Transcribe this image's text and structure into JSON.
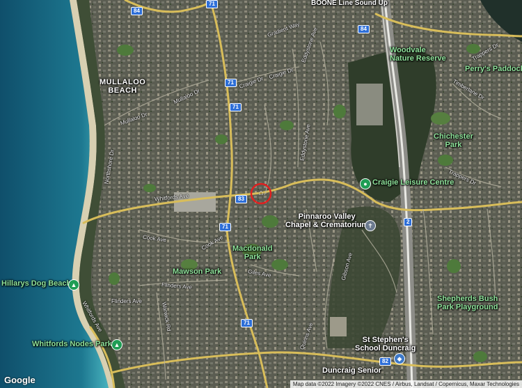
{
  "map": {
    "logo": "Google",
    "attribution": "Map data ©2022 Imagery ©2022 CNES / Airbus, Landsat / Copernicus, Maxar Technologies",
    "marker": "location-pin",
    "colors": {
      "ocean": "#1d6f8a",
      "shallow": "#3aa6b6",
      "land": "#5a5c50",
      "road": "#e8cf7a",
      "freeway": "#f3f3f3",
      "park_label": "#8fe39b",
      "marker": "#e02020"
    }
  },
  "labels": {
    "mullaloo_beach": "MULLALOO\nBEACH",
    "woodvale_reserve": "Woodvale\nNature Reserve",
    "perrys_paddock": "Perry's Paddock",
    "chichester_park": "Chichester\nPark",
    "craigie_leisure": "Craigie Leisure Centre",
    "pinnaroo": "Pinnaroo Valley\nChapel & Crematorium",
    "macdonald_park": "Macdonald\nPark",
    "mawson_park": "Mawson Park",
    "hillarys_dog_beach": "Hillarys Dog Beach",
    "whitfords_nodes": "Whitfords Nodes Park",
    "shepherds_bush": "Shepherds Bush\nPark Playground",
    "st_stephens": "St Stephen's\nSchool Duncraig",
    "duncraig_senior": "Duncraig Senior",
    "boone": "BOONE Line Sound Up"
  },
  "roads": {
    "whitfords_ave": "Whitfords Ave",
    "craigie_dr_1": "Craigie Dr",
    "craigie_dr_2": "Craigie Dr",
    "mullaloo_dr_1": "Mullaloo Dr",
    "mullaloo_dr_2": "Mullaloo Dr",
    "gradient_way": "Gradient Way",
    "eddystone_ave": "Eddystone Ave",
    "eddystone_ave_2": "Eddystone Ave",
    "timberlane_dr": "Timberlane Dr",
    "trappers_dr": "Trappers Dr",
    "trappers_dr_2": "Trappers Dr",
    "cook_ave": "Cook Ave",
    "cook_ave_2": "Cook Ave",
    "flinders_ave": "Flinders Ave",
    "flinders_ave_2": "Flinders Ave",
    "giles_ave": "Giles Ave",
    "gibson_ave": "Gibson Ave",
    "whitfords_ave_2": "Whitfords Ave",
    "northshore_dr": "Northshore Dr",
    "warwick_rd": "Warwick Rd",
    "quinns_ave": "Quinns Ave"
  },
  "shields": {
    "r71_a": "71",
    "r71_b": "71",
    "r71_c": "71",
    "r71_d": "71",
    "r71_e": "71",
    "r83": "83",
    "r84_a": "84",
    "r84_b": "84",
    "r82": "82",
    "r2": "2"
  }
}
